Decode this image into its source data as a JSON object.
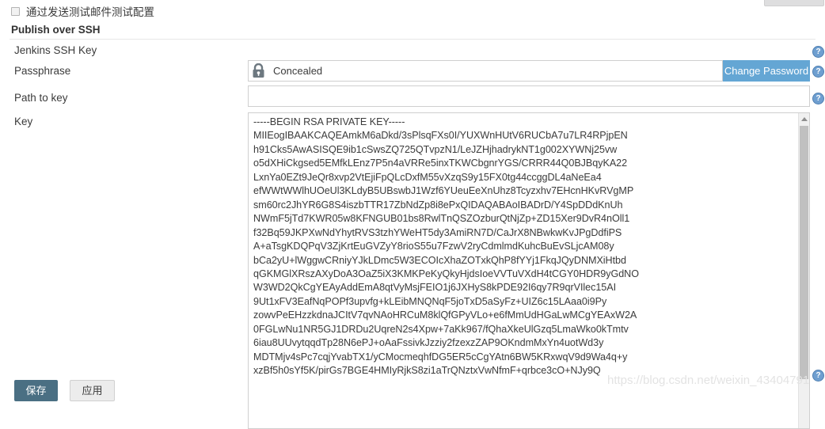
{
  "top_control": {
    "name": "partial-toolbar-stub"
  },
  "test_config": {
    "checkbox_label": "通过发送测试邮件测试配置",
    "checked": false
  },
  "section": {
    "heading": "Publish over SSH"
  },
  "form": {
    "rows": [
      {
        "label": "Jenkins SSH Key"
      },
      {
        "label": "Passphrase"
      },
      {
        "label": "Path to key"
      },
      {
        "label": "Key"
      }
    ],
    "passphrase": {
      "label": "Passphrase",
      "value": "Concealed",
      "lock_icon": "lock-icon",
      "change_password_label": "Change Password"
    },
    "path_to_key": {
      "label": "Path to key",
      "value": "",
      "placeholder": ""
    },
    "key": {
      "label": "Key",
      "value": "-----BEGIN RSA PRIVATE KEY-----\nMIIEogIBAAKCAQEAmkM6aDkd/3sPlsqFXs0I/YUXWnHUtV6RUCbA7u7LR4RPjpEN\nh91Cks5AwASISQE9ib1cSwsZQ725QTvpzN1/LeJZHjhadrykNT1g002XYWNj25vw\no5dXHiCkgsed5EMfkLEnz7P5n4aVRRe5inxTKWCbgnrYGS/CRRR44Q0BJBqyKA22\nLxnYa0EZt9JeQr8xvp2VtEjiFpQLcDxfM55vXzqS9y15FX0tg44ccggDL4aNeEa4\nefWWtWWlhUOeUl3KLdyB5UBswbJ1Wzf6YUeuEeXnUhz8Tcyzxhv7EHcnHKvRVgMP\nsm60rc2JhYR6G8S4iszbTTR17ZbNdZp8i8ePxQIDAQABAoIBADrD/Y4SpDDdKnUh\nNWmF5jTd7KWR05w8KFNGUB01bs8RwlTnQSZOzburQtNjZp+ZD15Xer9DvR4nOll1\nf32Bq59JKPXwNdYhytRVS3tzhYWeHT5dy3AmiRN7D/CaJrX8NBwkwKvJPgDdfiPS\nA+aTsgKDQPqV3ZjKrtEuGVZyY8rioS55u7FzwV2ryCdmlmdKuhcBuEvSLjcAM08y\nbCa2yU+lWggwCRniyYJkLDmc5W3ECOIcXhaZOTxkQhP8fYYj1FkqJQyDNMXiHtbd\nqGKMGlXRszAXyDoA3OaZ5iX3KMKPeKyQkyHjdsIoeVVTuVXdH4tCGY0HDR9yGdNO\nW3WD2QkCgYEAyAddEmA8qtVyMsjFEIO1j6JXHyS8kPDE92I6qy7R9qrVIlec15AI\n9Ut1xFV3EafNqPOPf3upvfg+kLEibMNQNqF5joTxD5aSyFz+UIZ6c15LAaa0i9Py\nzowvPeEHzzkdnaJCItV7qvNAoHRCuM8klQfGPyVLo+e6fMmUdHGaLwMCgYEAxW2A\n0FGLwNu1NR5GJ1DRDu2UqreN2s4Xpw+7aKk967/fQhaXkeUlGzq5LmaWko0kTmtv\n6iau8UUvytqqdTp28N6ePJ+oAaFssivkJzziy2fzexzZAP9OKndmMxYn4uotWd3y\nMDTMjv4sPc7cqjYvabTX1/yCMocmeqhfDG5ER5cCgYAtn6BW5KRxwqV9d9Wa4q+y\nxzBf5h0sYf5K/pirGs7BGE4HMIyRjkS8zi1aTrQNztxVwNfmF+qrbce3cO+NJy9Q",
      "scrollbar": "vertical"
    }
  },
  "buttons": {
    "save": "保存",
    "apply": "应用"
  },
  "help_icon_glyph": "?",
  "watermark": "https://blog.csdn.net/weixin_43404791",
  "colors": {
    "change_password_bg": "#64a6d4",
    "save_bg": "#4a6f83",
    "apply_bg": "#ececec",
    "help_icon": "#6f9fd0",
    "watermark": "#e3e3e3"
  }
}
